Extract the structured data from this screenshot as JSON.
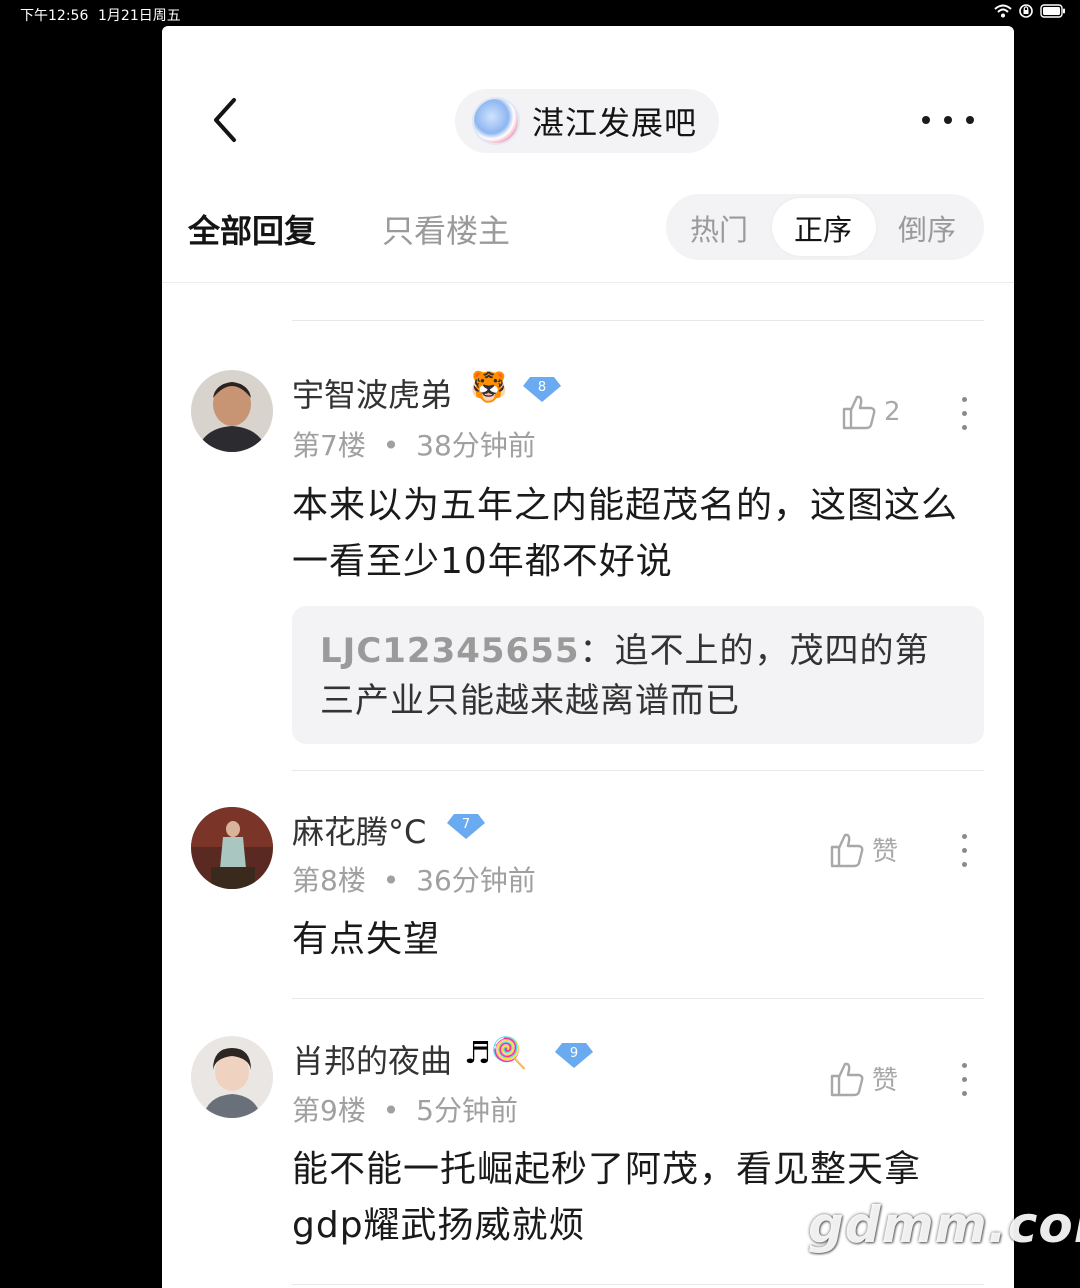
{
  "status_bar": {
    "time": "下午12:56",
    "date": "1月21日周五",
    "icons": [
      "wifi-icon",
      "rotation-lock-icon",
      "battery-icon"
    ]
  },
  "header": {
    "back_icon": "chevron-left-icon",
    "forum_name": "湛江发展吧",
    "more_icon": "more-horizontal-icon"
  },
  "tabs": {
    "all_replies": "全部回复",
    "owner_only": "只看楼主"
  },
  "sort": {
    "options": [
      "热门",
      "正序",
      "倒序"
    ],
    "selected": "正序"
  },
  "posts": [
    {
      "username": "宇智波虎弟",
      "emoji": "🐯",
      "level": "8",
      "floor": "第7楼",
      "time": "38分钟前",
      "likes": "2",
      "content": "本来以为五年之内能超茂名的，这图这么一看至少10年都不好说",
      "reply": {
        "user": "LJC12345655",
        "text": "：追不上的，茂四的第三产业只能越来越离谱而已"
      }
    },
    {
      "username": "麻花腾°C",
      "emoji": "",
      "level": "7",
      "floor": "第8楼",
      "time": "36分钟前",
      "likes": "赞",
      "content": "有点失望"
    },
    {
      "username": "肖邦的夜曲",
      "emoji": "♬🍭",
      "level": "9",
      "floor": "第9楼",
      "time": "5分钟前",
      "likes": "赞",
      "content": "能不能一托崛起秒了阿茂，看见整天拿gdp耀武扬威就烦"
    }
  ],
  "separator": "•",
  "watermark": "gdmm.com",
  "colors": {
    "level_badge": "#6aaaf0",
    "text_primary": "#1a1a1a",
    "text_muted": "#a0a0a0",
    "pill_bg": "#f3f3f5"
  }
}
